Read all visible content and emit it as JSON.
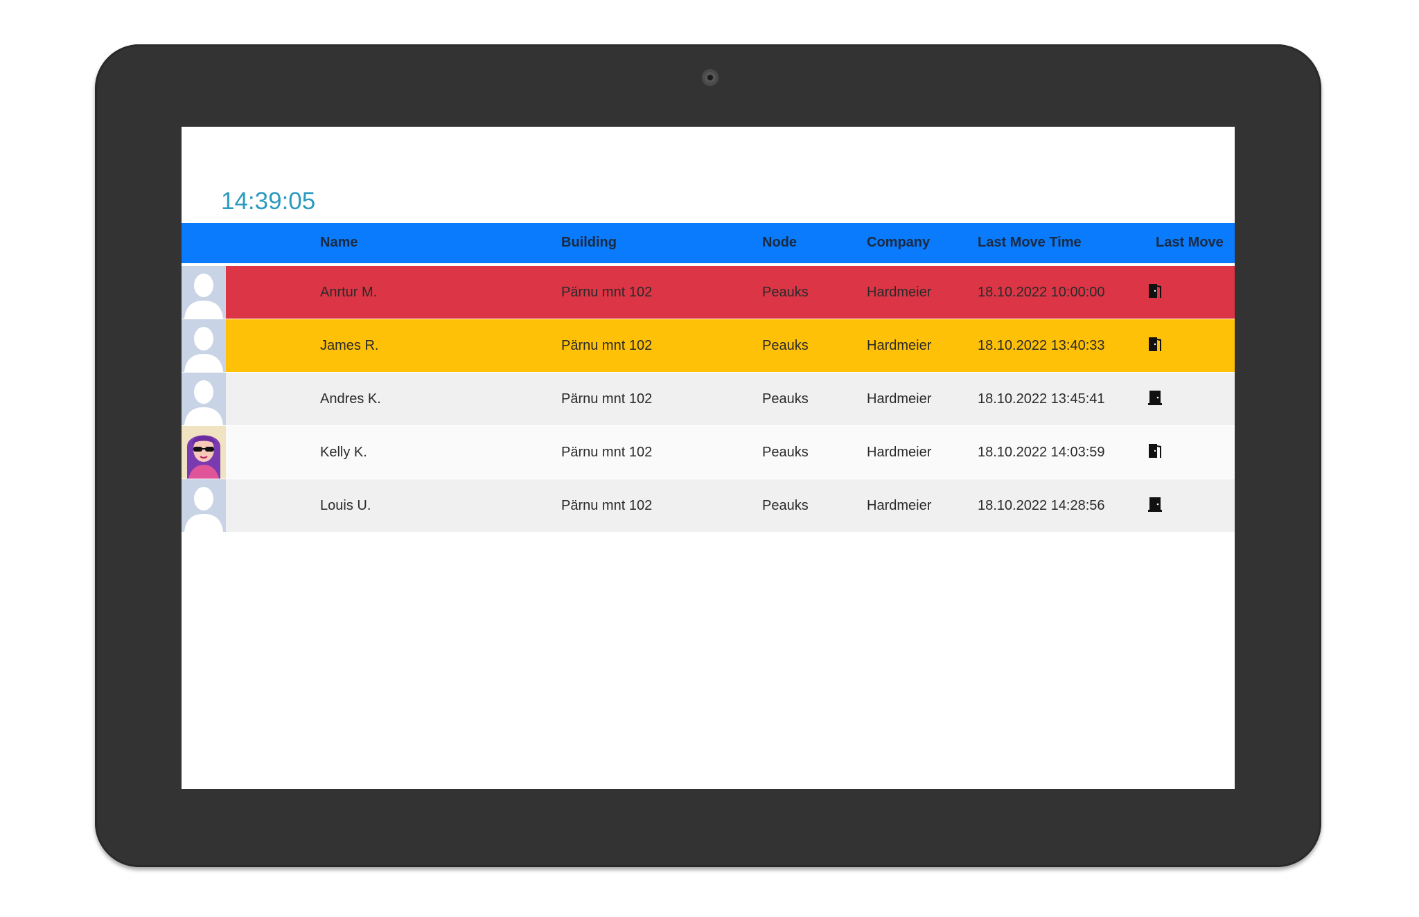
{
  "clock": "14:39:05",
  "columns": {
    "name": "Name",
    "building": "Building",
    "node": "Node",
    "company": "Company",
    "last_move_time": "Last Move Time",
    "last_move": "Last Move"
  },
  "colors": {
    "header": "#0a7bfc",
    "row_red": "#dc3545",
    "row_yellow": "#ffc107",
    "row_grey": "#f0f0f0",
    "row_white": "#fafafa"
  },
  "rows": [
    {
      "name": "Anrtur M.",
      "building": "Pärnu mnt 102",
      "node": "Peauks",
      "company": "Hardmeier",
      "time": "18.10.2022 10:00:00",
      "move_icon": "door-exit-icon",
      "avatar": "default-avatar-icon",
      "status_color": "#dc3545"
    },
    {
      "name": "James R.",
      "building": "Pärnu mnt 102",
      "node": "Peauks",
      "company": "Hardmeier",
      "time": "18.10.2022 13:40:33",
      "move_icon": "door-exit-icon",
      "avatar": "default-avatar-icon",
      "status_color": "#ffc107"
    },
    {
      "name": "Andres K.",
      "building": "Pärnu mnt 102",
      "node": "Peauks",
      "company": "Hardmeier",
      "time": "18.10.2022 13:45:41",
      "move_icon": "door-closed-icon",
      "avatar": "default-avatar-icon",
      "status_color": "#f0f0f0"
    },
    {
      "name": "Kelly K.",
      "building": "Pärnu mnt 102",
      "node": "Peauks",
      "company": "Hardmeier",
      "time": "18.10.2022 14:03:59",
      "move_icon": "door-exit-icon",
      "avatar": "woman-avatar-icon",
      "status_color": "#fafafa"
    },
    {
      "name": "Louis U.",
      "building": "Pärnu mnt 102",
      "node": "Peauks",
      "company": "Hardmeier",
      "time": "18.10.2022 14:28:56",
      "move_icon": "door-closed-icon",
      "avatar": "default-avatar-icon",
      "status_color": "#f0f0f0"
    }
  ]
}
